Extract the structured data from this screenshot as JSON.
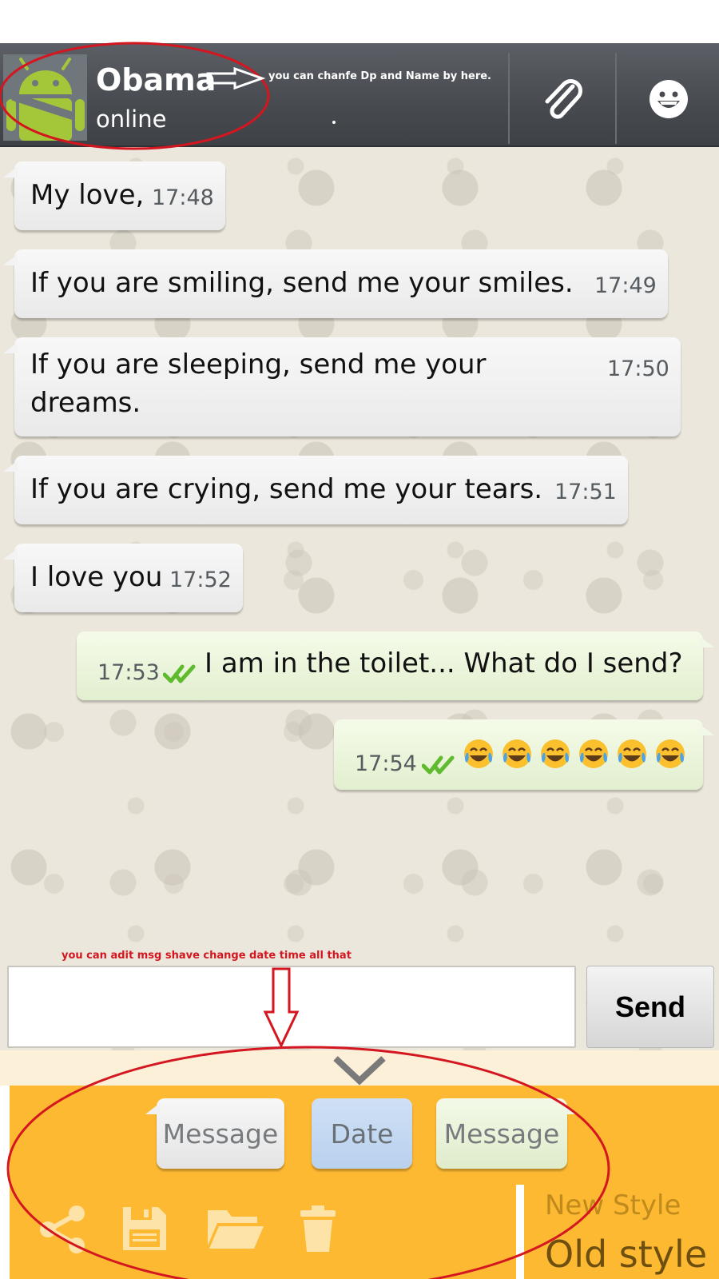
{
  "header": {
    "contact_name": "Obama",
    "contact_status": "online",
    "attach_icon": "paperclip-icon",
    "emoji_icon": "smiley-icon",
    "avatar_icon": "android-robot-icon"
  },
  "messages": [
    {
      "direction": "incoming",
      "text": "My love,",
      "time": "17:48"
    },
    {
      "direction": "incoming",
      "text": "If you are smiling, send me your smiles.",
      "time": "17:49"
    },
    {
      "direction": "incoming",
      "text_line1": "If you are sleeping, send me your",
      "text_line2": "dreams.",
      "time": "17:50"
    },
    {
      "direction": "incoming",
      "text": "If you are crying, send me your tears.",
      "time": "17:51"
    },
    {
      "direction": "incoming",
      "text": "I love you",
      "time": "17:52"
    },
    {
      "direction": "outgoing",
      "text": "I am in the toilet... What do I send?",
      "time": "17:53",
      "status": "double-tick-icon"
    },
    {
      "direction": "outgoing",
      "emoji": "crying-laughing-emoji",
      "emoji_count": 6,
      "time": "17:54",
      "status": "double-tick-icon"
    }
  ],
  "composer": {
    "input_value": "",
    "send_label": "Send"
  },
  "edit_panel": {
    "toggle_icon": "chevron-down-icon",
    "options": [
      "Message",
      "Date",
      "Message"
    ],
    "tools": [
      "share-icon",
      "save-icon",
      "folder-icon",
      "trash-icon"
    ],
    "style_new": "New Style",
    "style_old": "Old style"
  },
  "annotations": {
    "header_note": "you can chanfe Dp and Name by here.",
    "panel_note": "you can adit msg shave change date time all that",
    "color": "#d3161f"
  },
  "colors": {
    "header_bg": "#474b50",
    "chat_bg": "#ebe7dc",
    "outgoing_bubble": "#e2efcf",
    "panel_bg": "#fdb932",
    "tick_green": "#5fbb2e"
  }
}
